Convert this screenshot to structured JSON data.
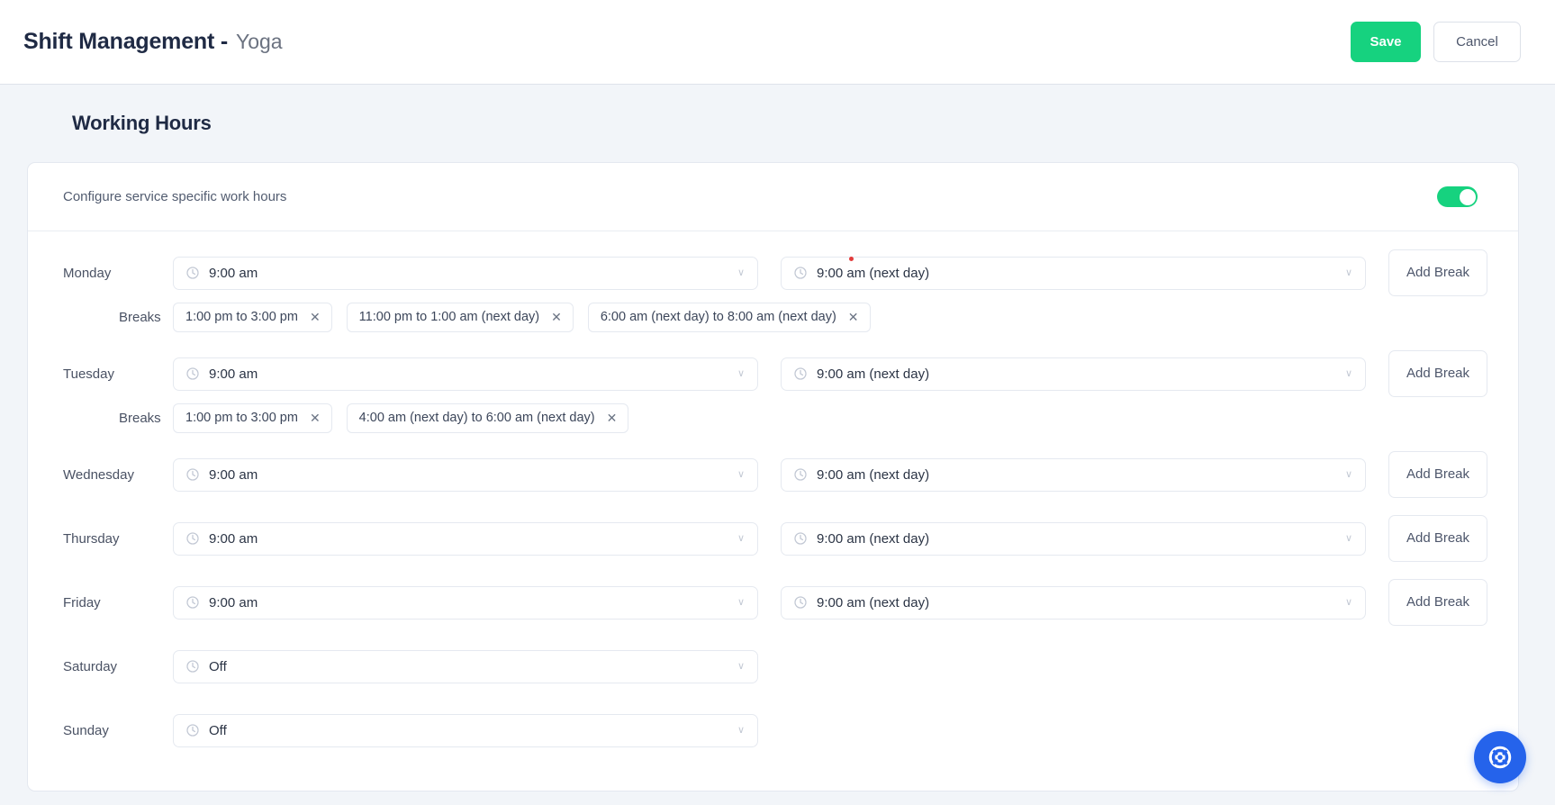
{
  "header": {
    "title_main": "Shift Management -",
    "title_sub": "Yoga",
    "save_label": "Save",
    "cancel_label": "Cancel"
  },
  "section": {
    "title": "Working Hours"
  },
  "card": {
    "configure_label": "Configure service specific work hours",
    "toggle_state": "on",
    "toggle_color": "#16d27f"
  },
  "labels": {
    "breaks": "Breaks",
    "add_break": "Add Break",
    "chevron": "∨",
    "chip_close": "✕"
  },
  "days": [
    {
      "name": "Monday",
      "start": "9:00 am",
      "end": "9:00 am (next day)",
      "has_end": true,
      "end_dot": true,
      "add_break": "Add Break",
      "breaks": [
        "1:00 pm to 3:00 pm",
        "11:00 pm to 1:00 am (next day)",
        "6:00 am (next day) to 8:00 am (next day)"
      ]
    },
    {
      "name": "Tuesday",
      "start": "9:00 am",
      "end": "9:00 am (next day)",
      "has_end": true,
      "end_dot": false,
      "add_break": "Add Break",
      "breaks": [
        "1:00 pm to 3:00 pm",
        "4:00 am (next day) to 6:00 am (next day)"
      ]
    },
    {
      "name": "Wednesday",
      "start": "9:00 am",
      "end": "9:00 am (next day)",
      "has_end": true,
      "end_dot": false,
      "add_break": "Add Break",
      "breaks": []
    },
    {
      "name": "Thursday",
      "start": "9:00 am",
      "end": "9:00 am (next day)",
      "has_end": true,
      "end_dot": false,
      "add_break": "Add Break",
      "breaks": []
    },
    {
      "name": "Friday",
      "start": "9:00 am",
      "end": "9:00 am (next day)",
      "has_end": true,
      "end_dot": false,
      "add_break": "Add Break",
      "breaks": []
    },
    {
      "name": "Saturday",
      "start": "Off",
      "end": "",
      "has_end": false,
      "end_dot": false,
      "add_break": "",
      "breaks": []
    },
    {
      "name": "Sunday",
      "start": "Off",
      "end": "",
      "has_end": false,
      "end_dot": false,
      "add_break": "",
      "breaks": []
    }
  ],
  "fab": {
    "icon": "lifebuoy-icon",
    "color": "#2563eb"
  }
}
